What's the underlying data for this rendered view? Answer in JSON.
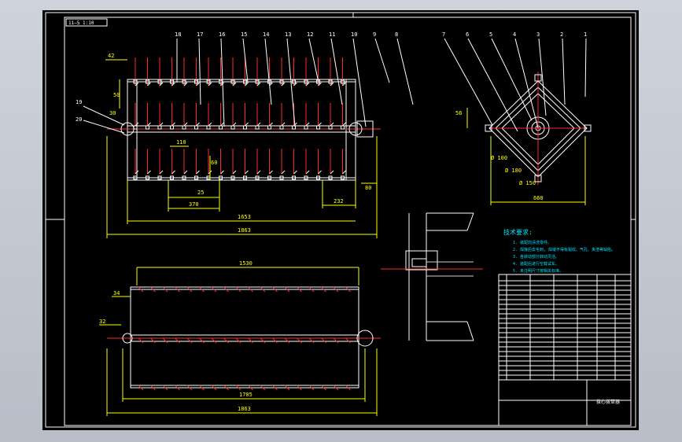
{
  "drawing": {
    "view_label": "11—5 1:10",
    "part_numbers_front": [
      "18",
      "17",
      "16",
      "15",
      "14",
      "13",
      "12",
      "11",
      "10",
      "9",
      "8"
    ],
    "part_numbers_side": [
      "7",
      "6",
      "5",
      "4",
      "3",
      "2",
      "1"
    ],
    "side_callouts": [
      "19",
      "20"
    ],
    "dimensions_front": {
      "d42": "42",
      "d50": "50",
      "d30": "30",
      "d110": "110",
      "d60": "60",
      "d25": "25",
      "d370": "370",
      "d232": "232",
      "d80": "80",
      "d1653a": "1653",
      "d1863a": "1863"
    },
    "dimensions_side": {
      "d56": "56",
      "phi100": "Ø 100",
      "phi180": "Ø 180",
      "phi150": "Ø 150",
      "d660": "660"
    },
    "dimensions_bottom": {
      "d1530": "1530",
      "d34": "34",
      "d32": "32",
      "d1705": "1705",
      "d1863b": "1863"
    },
    "tech_title": "技术要求:",
    "tech_notes": [
      "1. 装配前清洗零件。",
      "2. 焊接后去毛刺, 焊缝不得有裂纹、气孔、夹渣等缺陷。",
      "3. 各转动部分转动灵活。",
      "4. 装配后进行空载试车。",
      "5. 未注明尺寸按相关标准。"
    ],
    "title_block": {
      "drawing_name": "拨心拨草器"
    }
  }
}
